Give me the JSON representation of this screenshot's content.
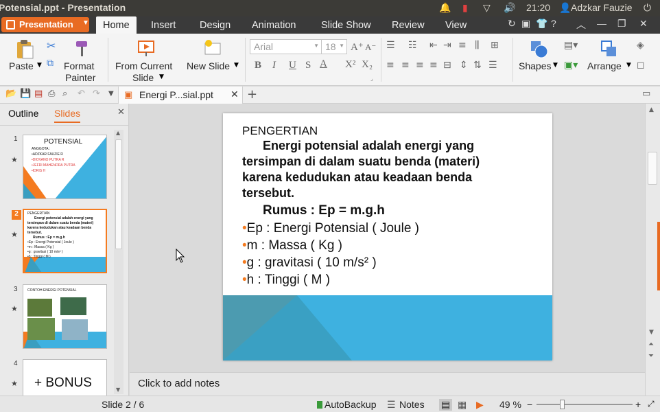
{
  "window": {
    "title": "Potensial.ppt - Presentation",
    "clock": "21:20",
    "user": "Adzkar Fauzie"
  },
  "app_button": {
    "label": "Presentation"
  },
  "menu": {
    "tabs": [
      {
        "label": "Home",
        "active": true
      },
      {
        "label": "Insert"
      },
      {
        "label": "Design"
      },
      {
        "label": "Animation"
      },
      {
        "label": "Slide Show"
      },
      {
        "label": "Review"
      },
      {
        "label": "View"
      }
    ]
  },
  "ribbon": {
    "paste": "Paste",
    "format_painter": [
      "Format",
      "Painter"
    ],
    "from_current": [
      "From Current",
      "Slide"
    ],
    "new_slide": "New Slide",
    "font_name": "Arial",
    "font_size": "18",
    "shapes": "Shapes",
    "arrange": "Arrange"
  },
  "doc_tab": {
    "label": "Energi P...sial.ppt"
  },
  "left_panel": {
    "tabs": [
      {
        "label": "Outline"
      },
      {
        "label": "Slides",
        "active": true
      }
    ],
    "thumbs": [
      {
        "num": "1",
        "title": "POTENSIAL",
        "lines": [
          "ANGGOTA :",
          "•ADZKAR FAUZIE R",
          "•DIOVANO PUTRA R",
          "•JEFRI MAHENDRA PUTRA",
          "•IDRIS H"
        ]
      },
      {
        "num": "2",
        "lines": [
          "PENGERTIAN",
          "Energi potensial adalah energi yang",
          "tersimpan di dalam suatu benda (materi)",
          "karena kedudukan atau keadaan benda",
          "tersebut.",
          "Rumus : Ep = m.g.h",
          "•Ep : Energi Potensial ( Joule )",
          "•m : Massa ( Kg )",
          "•g : gravitasi ( 10 m/s² )",
          "•h : Tinggi ( M )"
        ]
      },
      {
        "num": "3",
        "title": "CONTOH ENERGI POTENSIAL"
      },
      {
        "num": "4",
        "title": "+ BONUS"
      }
    ]
  },
  "slide": {
    "heading": "PENGERTIAN",
    "para": [
      "Energi potensial adalah energi yang",
      "tersimpan di dalam suatu benda (materi)",
      "karena kedudukan atau keadaan benda",
      "tersebut."
    ],
    "rumus": "Rumus :  Ep = m.g.h",
    "bullets": [
      "Ep : Energi Potensial ( Joule )",
      "m : Massa ( Kg )",
      "g : gravitasi ( 10 m/s² )",
      "h : Tinggi ( M )"
    ],
    "colors": {
      "orange": "#f47b20",
      "blue": "#3eb1e0",
      "teal": "#3a9ec0"
    }
  },
  "notes": {
    "placeholder": "Click to add notes"
  },
  "status": {
    "slide": "Slide 2 / 6",
    "autobackup": "AutoBackup",
    "notes": "Notes",
    "zoom": "49 %"
  }
}
